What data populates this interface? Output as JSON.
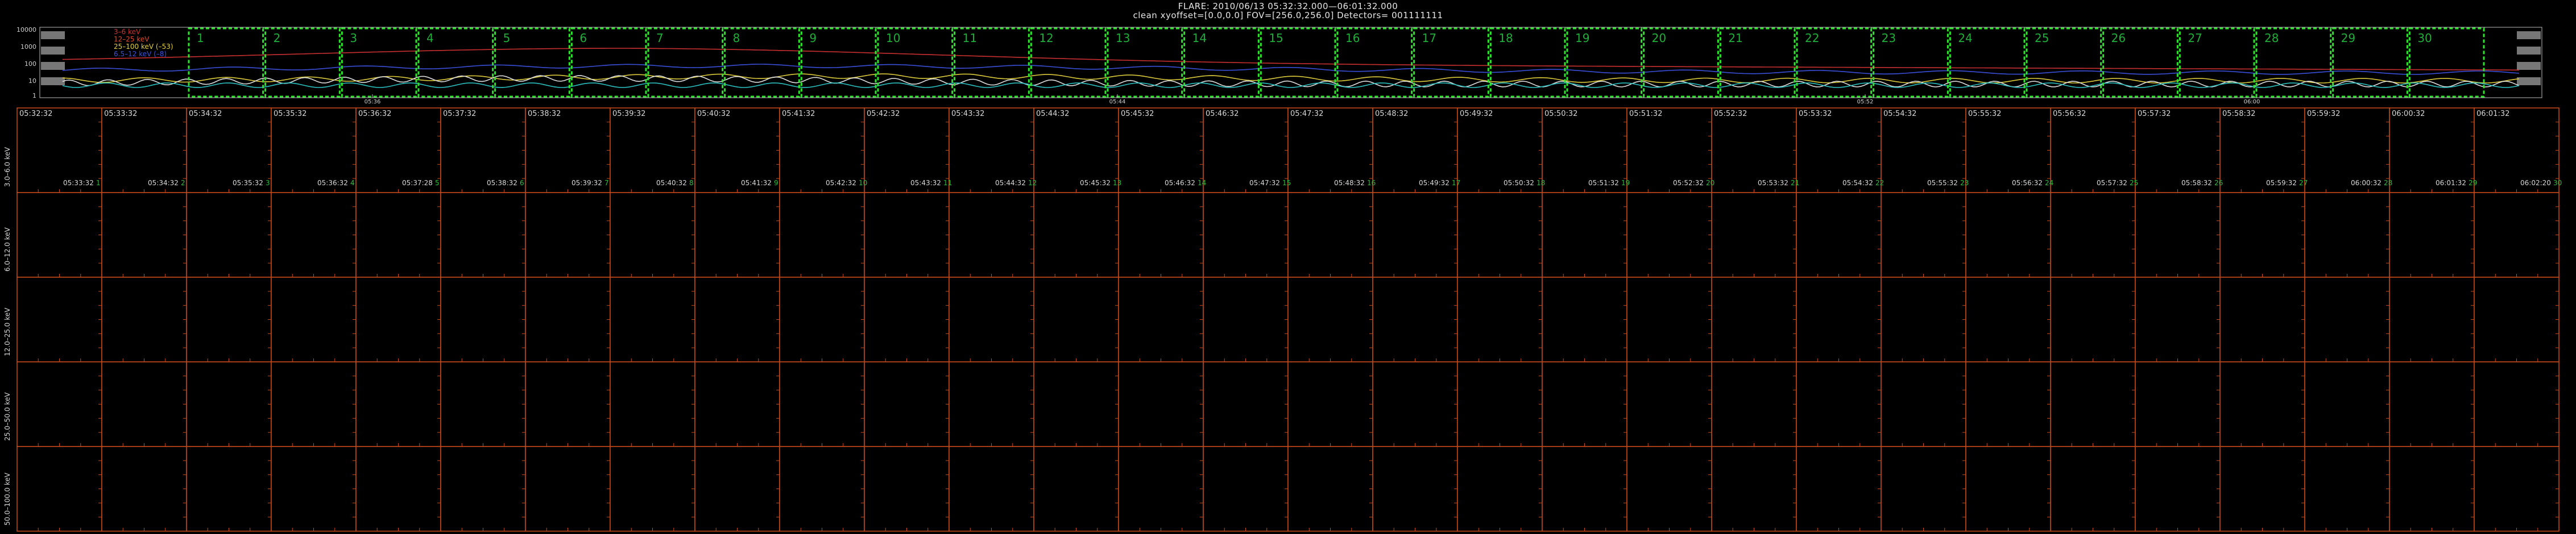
{
  "header": {
    "title": "FLARE: 2010/06/13 05:32:32.000—06:01:32.000",
    "subtitle": "clean    xyoffset=[0.0,0.0]    FOV=[256.0,256.0]    Detectors= 001111111"
  },
  "lightcurve": {
    "ylabels": [
      "10000",
      "1000",
      "100",
      "10",
      "1"
    ],
    "legend": [
      {
        "label": "3–6 keV",
        "color": "#d03030"
      },
      {
        "label": "12–25 keV",
        "color": "#e04a2a"
      },
      {
        "label": "25–100 keV (–53)",
        "color": "#e6d23a"
      },
      {
        "label": "6.5–12 keV (–8)",
        "color": "#3a52e0"
      }
    ],
    "xticks": [
      "05:36",
      "05:44",
      "05:52",
      "06:00"
    ],
    "boxes": [
      "1",
      "2",
      "3",
      "4",
      "5",
      "6",
      "7",
      "8",
      "9",
      "10",
      "11",
      "12",
      "13",
      "14",
      "15",
      "16",
      "17",
      "18",
      "19",
      "20",
      "21",
      "22",
      "23",
      "24",
      "25",
      "26",
      "27",
      "28",
      "29",
      "30"
    ],
    "colors": {
      "box": "#2fe32f",
      "red": "#c83030",
      "blue": "#3a4fd8",
      "yellow": "#d9c93a",
      "white": "#dddddd",
      "cyan": "#2ac0c0"
    }
  },
  "grid": {
    "energy_bands": [
      "3.0–6.0 keV",
      "6.0–12.0 keV",
      "12.0–25.0 keV",
      "25.0–50.0 keV",
      "50.0–100.0 keV"
    ],
    "start_times": [
      "05:32:32",
      "05:33:32",
      "05:34:32",
      "05:35:32",
      "05:36:32",
      "05:37:32",
      "05:38:32",
      "05:39:32",
      "05:40:32",
      "05:41:32",
      "05:42:32",
      "05:43:32",
      "05:44:32",
      "05:45:32",
      "05:46:32",
      "05:47:32",
      "05:48:32",
      "05:49:32",
      "05:50:32",
      "05:51:32",
      "05:52:32",
      "05:53:32",
      "05:54:32",
      "05:55:32",
      "05:56:32",
      "05:57:32",
      "05:58:32",
      "05:59:32",
      "06:00:32",
      "06:01:32"
    ],
    "end_times": [
      "05:33:32",
      "05:34:32",
      "05:35:32",
      "05:36:32",
      "05:37:28",
      "05:38:32",
      "05:39:32",
      "05:40:32",
      "05:41:32",
      "05:42:32",
      "05:43:32",
      "05:44:32",
      "05:45:32",
      "05:46:32",
      "05:47:32",
      "05:48:32",
      "05:49:32",
      "05:50:32",
      "05:51:32",
      "05:52:32",
      "05:53:32",
      "05:54:32",
      "05:55:32",
      "05:56:32",
      "05:57:32",
      "05:58:32",
      "05:59:32",
      "06:00:32",
      "06:01:32",
      "06:02:20"
    ],
    "cell_numbers": [
      "1",
      "2",
      "3",
      "4",
      "5",
      "6",
      "7",
      "8",
      "9",
      "10",
      "11",
      "12",
      "13",
      "14",
      "15",
      "16",
      "17",
      "18",
      "19",
      "20",
      "21",
      "22",
      "23",
      "24",
      "25",
      "26",
      "27",
      "28",
      "29",
      "30"
    ],
    "colors": {
      "frame": "#c84a1a"
    }
  }
}
